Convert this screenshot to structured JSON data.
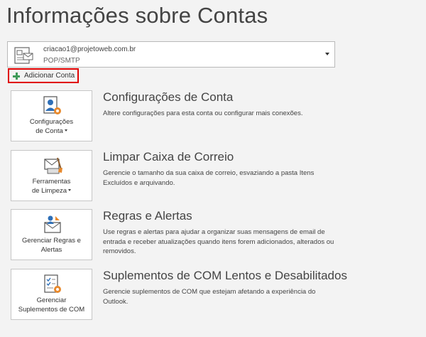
{
  "page": {
    "title": "Informações sobre Contas"
  },
  "account": {
    "email": "criacao1@projetoweb.com.br",
    "type": "POP/SMTP"
  },
  "add_account": {
    "label": "Adicionar Conta"
  },
  "sections": [
    {
      "tile_label_line1": "Configurações",
      "tile_label_line2": "de Conta",
      "title": "Configurações de Conta",
      "description": "Altere configurações para esta conta ou configurar mais conexões."
    },
    {
      "tile_label_line1": "Ferramentas",
      "tile_label_line2": "de Limpeza",
      "title": "Limpar Caixa de Correio",
      "description": "Gerencie o tamanho da sua caixa de correio, esvaziando a pasta Itens Excluídos e arquivando."
    },
    {
      "tile_label_line1": "Gerenciar Regras e",
      "tile_label_line2": "Alertas",
      "title": "Regras e Alertas",
      "description": "Use regras e alertas para ajudar a organizar suas mensagens de email de entrada e receber atualizações quando itens forem adicionados, alterados ou removidos."
    },
    {
      "tile_label_line1": "Gerenciar",
      "tile_label_line2": "Suplementos de COM",
      "title": "Suplementos de COM Lentos e Desabilitados",
      "description": "Gerencie suplementos de COM que estejam afetando a experiência do Outlook."
    }
  ],
  "icons": {
    "account": "account-card-icon",
    "add": "plus-icon",
    "settings": "account-settings-icon",
    "cleanup": "mailbox-cleanup-icon",
    "rules": "rules-alerts-icon",
    "addins": "com-addins-icon"
  },
  "colors": {
    "accent_green": "#3f9b59",
    "highlight_red": "#e00000",
    "gear_orange": "#e8892c",
    "avatar_blue": "#2e6fb7"
  }
}
